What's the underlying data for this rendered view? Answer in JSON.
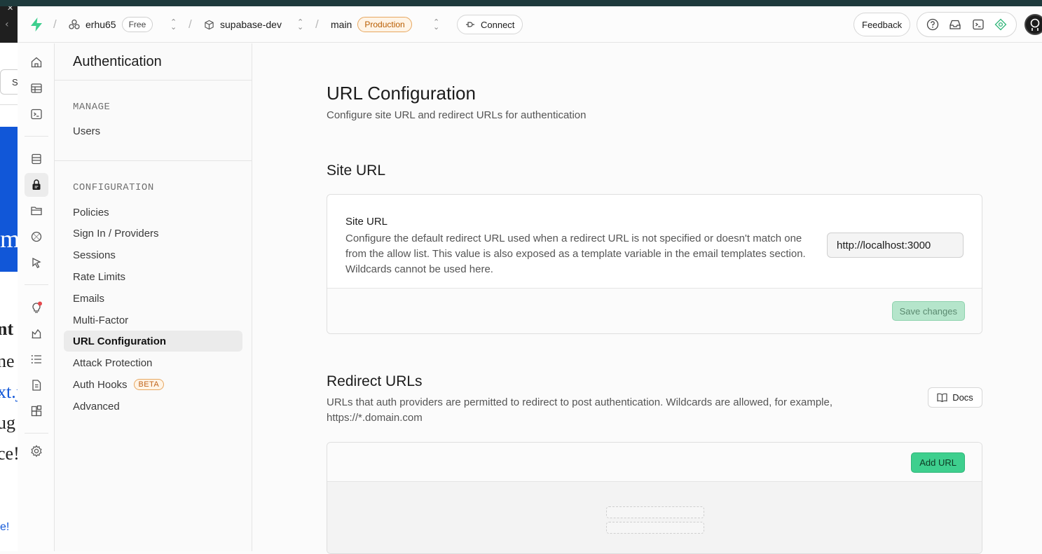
{
  "topbar": {
    "org_name": "erhu65",
    "org_plan": "Free",
    "project_name": "supabase-dev",
    "branch_name": "main",
    "branch_env": "Production",
    "connect_label": "Connect",
    "feedback_label": "Feedback"
  },
  "background_page": {
    "search_fragment": "S",
    "big_letter": "m",
    "text_lines": [
      "nt",
      "ne",
      "xt.j",
      "ug",
      "ce!"
    ],
    "footer_fragment": "e!"
  },
  "menu": {
    "title": "Authentication",
    "sections": [
      {
        "heading": "MANAGE",
        "items": [
          {
            "label": "Users"
          }
        ]
      },
      {
        "heading": "CONFIGURATION",
        "items": [
          {
            "label": "Policies"
          },
          {
            "label": "Sign In / Providers"
          },
          {
            "label": "Sessions"
          },
          {
            "label": "Rate Limits"
          },
          {
            "label": "Emails"
          },
          {
            "label": "Multi-Factor"
          },
          {
            "label": "URL Configuration"
          },
          {
            "label": "Attack Protection"
          },
          {
            "label": "Auth Hooks",
            "badge": "BETA"
          },
          {
            "label": "Advanced"
          }
        ]
      }
    ],
    "active_item": "URL Configuration"
  },
  "page": {
    "title": "URL Configuration",
    "subtitle": "Configure site URL and redirect URLs for authentication",
    "site_url_section": {
      "heading": "Site URL",
      "field_label": "Site URL",
      "field_description": "Configure the default redirect URL used when a redirect URL is not specified or doesn't match one from the allow list. This value is also exposed as a template variable in the email templates section. Wildcards cannot be used here.",
      "field_value": "http://localhost:3000",
      "save_label": "Save changes"
    },
    "redirect_section": {
      "heading": "Redirect URLs",
      "description": "URLs that auth providers are permitted to redirect to post authentication. Wildcards are allowed, for example, https://*.domain.com",
      "docs_label": "Docs",
      "add_label": "Add URL"
    }
  },
  "colors": {
    "brand": "#3ecf8e",
    "production_badge": "#e7a760",
    "notification_dot": "#e5484d"
  },
  "rail_icons": [
    "home-icon",
    "table-editor-icon",
    "sql-editor-icon",
    "database-icon",
    "authentication-icon",
    "storage-icon",
    "realtime-icon",
    "edge-functions-icon",
    "advisors-icon",
    "reports-icon",
    "logs-icon",
    "api-docs-icon",
    "integrations-icon",
    "settings-icon"
  ]
}
